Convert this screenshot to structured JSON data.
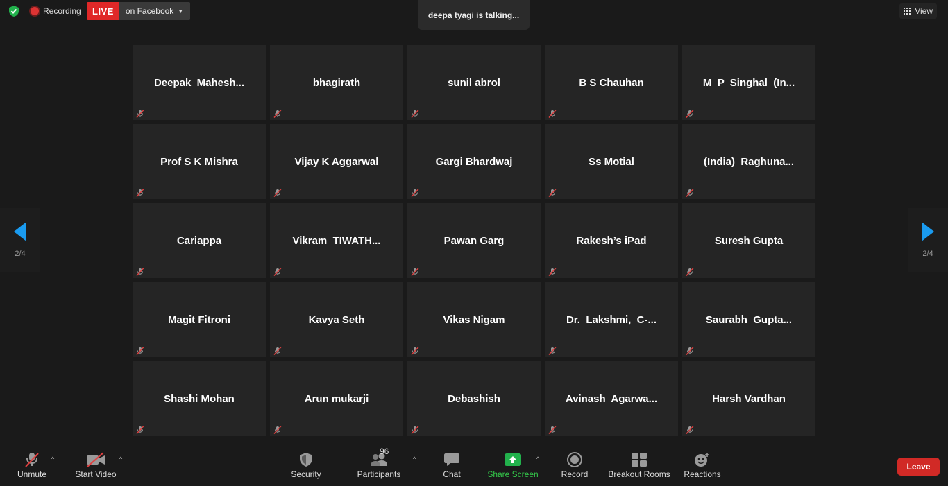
{
  "topbar": {
    "recording_label": "Recording",
    "live_badge": "LIVE",
    "live_destination": "on Facebook",
    "talking_banner": "deepa tyagi is talking...",
    "view_label": "View"
  },
  "navigation": {
    "left_page": "2/4",
    "right_page": "2/4"
  },
  "participants": [
    {
      "name": "Deepak  Mahesh..."
    },
    {
      "name": "bhagirath"
    },
    {
      "name": "sunil abrol"
    },
    {
      "name": "B S Chauhan"
    },
    {
      "name": "M  P  Singhal  (In..."
    },
    {
      "name": "Prof S K Mishra"
    },
    {
      "name": "Vijay K Aggarwal"
    },
    {
      "name": "Gargi Bhardwaj"
    },
    {
      "name": "Ss Motial"
    },
    {
      "name": "(India)  Raghuna..."
    },
    {
      "name": "Cariappa"
    },
    {
      "name": "Vikram  TIWATH..."
    },
    {
      "name": "Pawan Garg"
    },
    {
      "name": "Rakesh’s iPad"
    },
    {
      "name": "Suresh Gupta"
    },
    {
      "name": "Magit Fitroni"
    },
    {
      "name": "Kavya Seth"
    },
    {
      "name": "Vikas Nigam"
    },
    {
      "name": "Dr.  Lakshmi,  C-..."
    },
    {
      "name": "Saurabh  Gupta..."
    },
    {
      "name": "Shashi Mohan"
    },
    {
      "name": "Arun mukarji"
    },
    {
      "name": "Debashish"
    },
    {
      "name": "Avinash  Agarwa..."
    },
    {
      "name": "Harsh Vardhan"
    }
  ],
  "toolbar": {
    "unmute_label": "Unmute",
    "start_video_label": "Start Video",
    "security_label": "Security",
    "participants_label": "Participants",
    "participants_count": "96",
    "chat_label": "Chat",
    "share_screen_label": "Share Screen",
    "record_label": "Record",
    "breakout_label": "Breakout Rooms",
    "reactions_label": "Reactions",
    "leave_label": "Leave"
  },
  "colors": {
    "live_red": "#e02828",
    "share_green": "#34c84a",
    "nav_blue": "#1a9bf0",
    "leave_red": "#d12a26",
    "muted_red": "#e04040"
  }
}
